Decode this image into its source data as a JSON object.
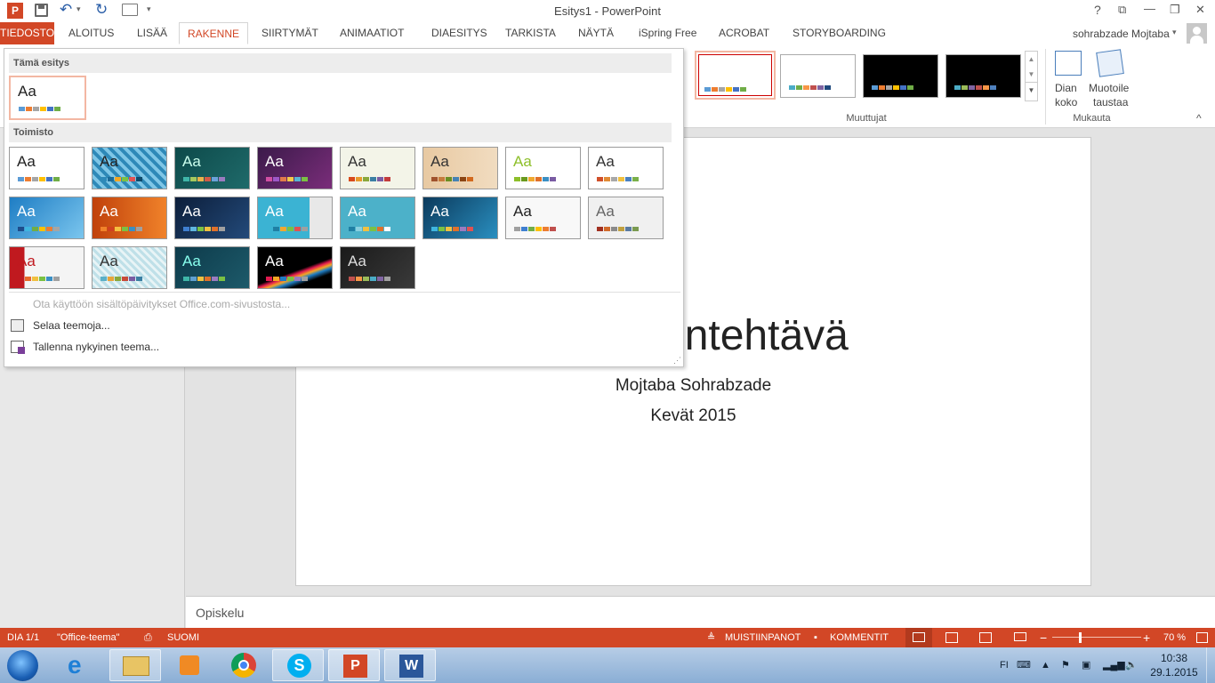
{
  "app": {
    "title": "Esitys1 - PowerPoint"
  },
  "quick_access": {
    "undo_caret": "▾",
    "more": "▾"
  },
  "window": {
    "help": "?",
    "ribbon_display": "⧉",
    "minimize": "—",
    "restore": "❐",
    "close": "✕"
  },
  "tabs": [
    {
      "label": "TIEDOSTO"
    },
    {
      "label": "ALOITUS"
    },
    {
      "label": "LISÄÄ"
    },
    {
      "label": "RAKENNE"
    },
    {
      "label": "SIIRTYMÄT"
    },
    {
      "label": "ANIMAATIOT"
    },
    {
      "label": "DIAESITYS"
    },
    {
      "label": "TARKISTA"
    },
    {
      "label": "NÄYTÄ"
    },
    {
      "label": "iSpring Free"
    },
    {
      "label": "ACROBAT"
    },
    {
      "label": "STORYBOARDING"
    }
  ],
  "user": {
    "name": "sohrabzade Mojtaba",
    "caret": "▾"
  },
  "ribbon": {
    "variants_group": "Muuttujat",
    "customize_group": "Mukauta",
    "slide_size_line1": "Dian",
    "slide_size_line2": "koko",
    "format_bg_line1": "Muotoile",
    "format_bg_line2": "taustaa",
    "collapse": "^"
  },
  "dropdown": {
    "section_this": "Tämä esitys",
    "section_office": "Toimisto",
    "menu": {
      "enable_updates": "Ota käyttöön sisältöpäivitykset Office.com-sivustosta...",
      "browse": "Selaa teemoja...",
      "save": "Tallenna nykyinen teema..."
    },
    "theme_label": "Aa",
    "resize": "⋰"
  },
  "slide": {
    "title_fragment": "entehtävä",
    "subtitle_1": "Mojtaba Sohrabzade",
    "subtitle_2": "Kevät 2015"
  },
  "notes": {
    "text": "Opiskelu"
  },
  "status": {
    "slide": "DIA 1/1",
    "theme": "\"Office-teema\"",
    "language": "SUOMI",
    "notes": "MUISTIINPANOT",
    "comments": "KOMMENTIT",
    "zoom": "70 %",
    "minus": "−",
    "plus": "+"
  },
  "taskbar": {
    "lang": "FI",
    "time": "10:38",
    "date": "29.1.2015"
  },
  "colors": {
    "accent": "#d24726",
    "bar_office": [
      "#5b9bd5",
      "#ed7d31",
      "#a5a5a5",
      "#ffc000",
      "#4472c4",
      "#70ad47"
    ]
  }
}
